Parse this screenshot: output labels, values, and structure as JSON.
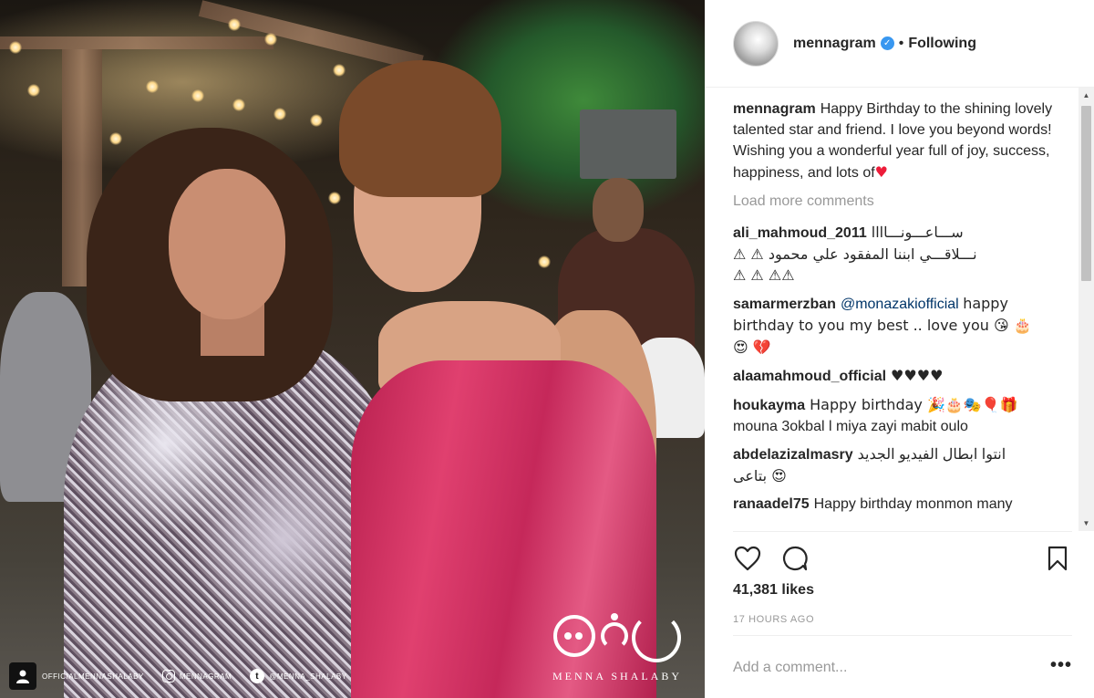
{
  "photo": {
    "watermark": {
      "symbol": "ﻣﻨﺔ",
      "text": "MENNA SHALABY"
    },
    "credits": [
      {
        "icon": "user-square-icon",
        "label": "OFFICIALMENNASHALABY"
      },
      {
        "icon": "instagram-icon",
        "label": "MENNAGRAM"
      },
      {
        "icon": "twitter-icon",
        "label": "@MENNA_SHALABY"
      }
    ]
  },
  "header": {
    "username": "mennagram",
    "verified_mark": "✓",
    "separator": "•",
    "follow_status": "Following"
  },
  "caption": {
    "username": "mennagram",
    "line1": "Happy Birthday to the shining lovely talented star and friend. I love you beyond words!",
    "line2": "Wishing you a wonderful year full of joy, success, happiness, and lots of",
    "line2_emoji": "♥"
  },
  "load_more": "Load more comments",
  "comments": [
    {
      "username": "ali_mahmoud_2011",
      "text": "ســـاعـــونـــاااا",
      "text2": "نـــلاقـــي ابننا المفقود علي محمود ⚠ ⚠",
      "text3": "⚠ ⚠ ⚠⚠"
    },
    {
      "username": "samarmerzban",
      "mention": "@monazakiofficial",
      "text": "happy birthday to you my best .. love you 😘 🎂",
      "text2": "😍 💔"
    },
    {
      "username": "alaamahmoud_official",
      "text": "♥♥♥♥"
    },
    {
      "username": "houkayma",
      "text": "Happy birthday 🎉🎂🎭🎈🎁",
      "text2": "mouna 3okbal l miya zayi mabit oulo"
    },
    {
      "username": "abdelazizalmasry",
      "text": "انتوا ابطال الفيديو الجديد",
      "text2": "بتاعى 😍"
    },
    {
      "username": "ranaadel75",
      "text": "Happy birthday monmon many"
    }
  ],
  "scrollbar": {
    "up": "▲",
    "down": "▼"
  },
  "actions": {
    "like_icon": "heart-icon",
    "comment_icon": "comment-icon",
    "save_icon": "bookmark-icon"
  },
  "likes": "41,381 likes",
  "timestamp": "17 HOURS AGO",
  "add_comment": {
    "placeholder": "Add a comment..."
  },
  "more_options": "•••"
}
